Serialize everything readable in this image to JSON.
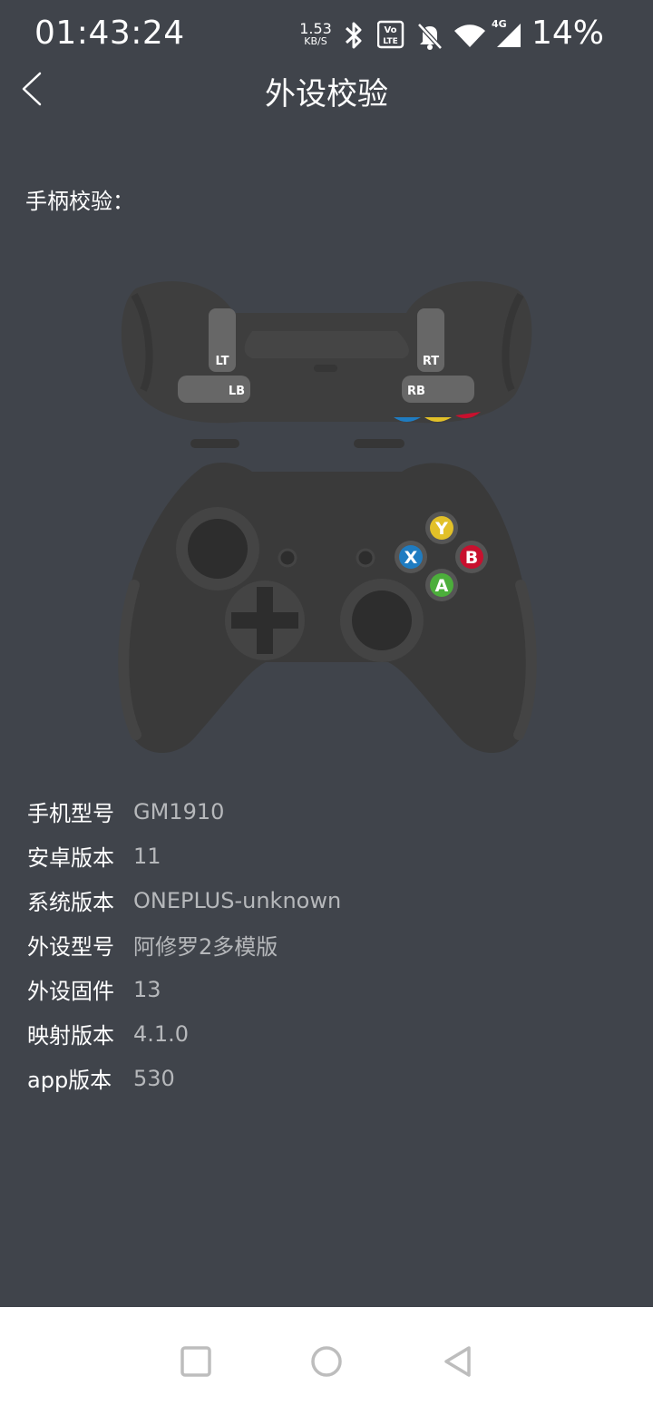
{
  "status_bar": {
    "time": "01:43:24",
    "net_speed_value": "1.53",
    "net_speed_unit": "KB/S",
    "network_type": "4G",
    "battery": "14%",
    "icons": [
      "bluetooth-icon",
      "volte-icon",
      "mute-icon",
      "wifi-icon",
      "cellular-signal-icon"
    ]
  },
  "header": {
    "title": "外设校验",
    "back_icon": "chevron-left-icon"
  },
  "section_label": "手柄校验：",
  "controller": {
    "triggers": [
      "LT",
      "LB",
      "RT",
      "RB"
    ],
    "face_buttons": [
      "Y",
      "X",
      "B",
      "A"
    ],
    "colors": {
      "body": "#3a3a3a",
      "y": "#e2c028",
      "x": "#1f7cc1",
      "b": "#c8102e",
      "a": "#4cae3b"
    }
  },
  "device_info": [
    {
      "key": "手机型号",
      "value": "GM1910"
    },
    {
      "key": "安卓版本",
      "value": "11"
    },
    {
      "key": "系统版本",
      "value": "ONEPLUS-unknown"
    },
    {
      "key": "外设型号",
      "value": "阿修罗2多模版"
    },
    {
      "key": "外设固件",
      "value": "13"
    },
    {
      "key": "映射版本",
      "value": "4.1.0"
    },
    {
      "key": "app版本",
      "value": "530"
    }
  ],
  "nav_bar": {
    "buttons": [
      "recents-square-icon",
      "home-circle-icon",
      "back-triangle-icon"
    ]
  },
  "theme": {
    "background": "#40444b",
    "nav_background": "#ffffff",
    "value_color": "#b6b8bb"
  }
}
